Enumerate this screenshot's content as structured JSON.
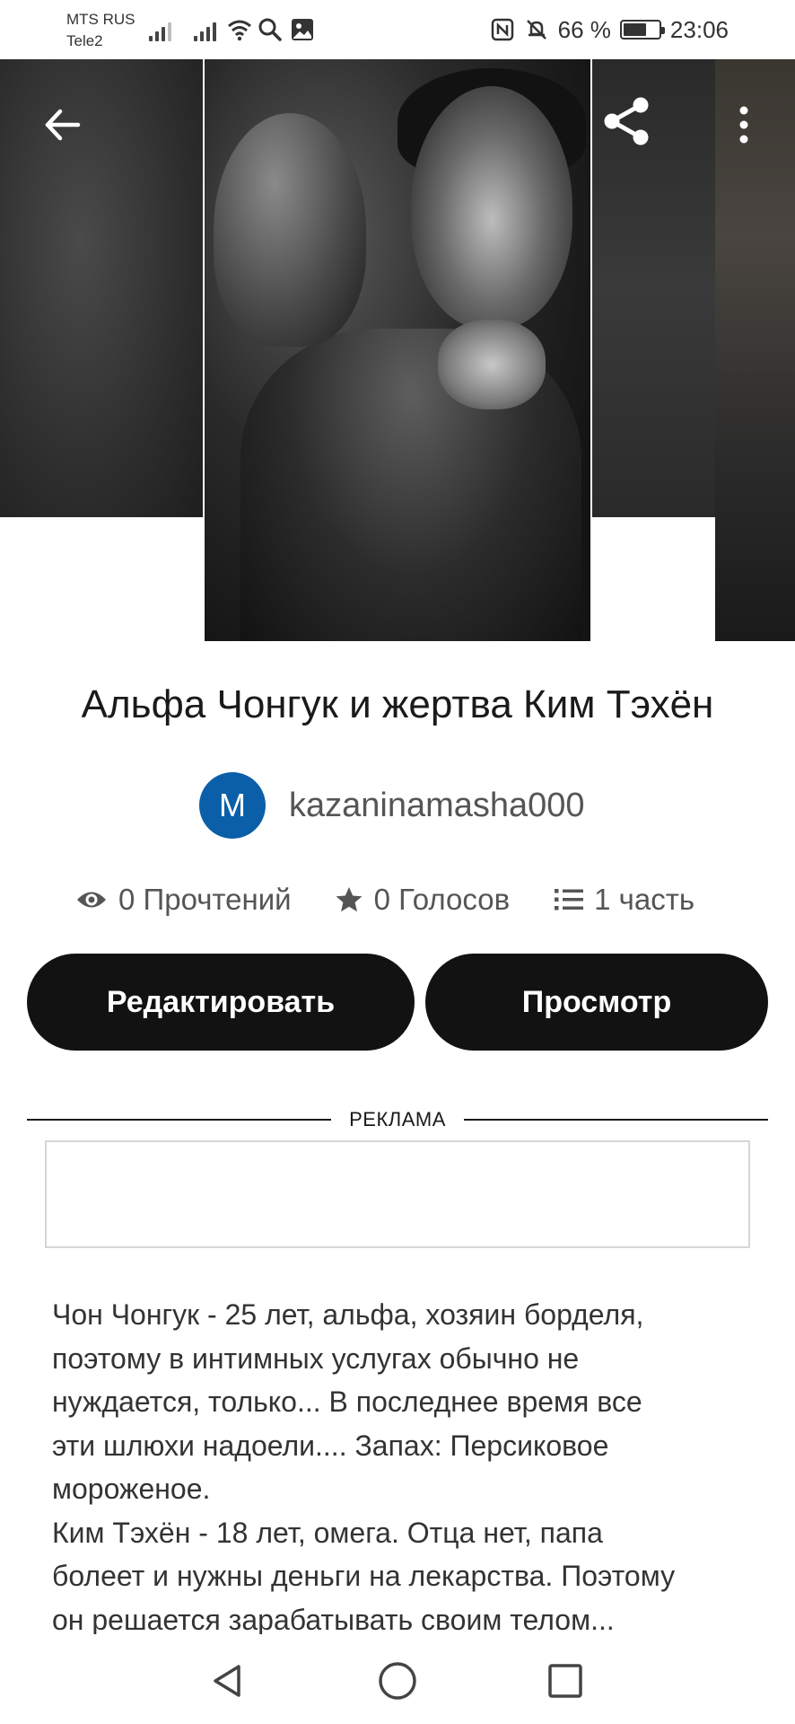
{
  "status_bar": {
    "carrier1": "MTS RUS",
    "carrier2": "Tele2",
    "battery": "66 %",
    "battery_level": 0.66,
    "time": "23:06"
  },
  "story": {
    "title": "Альфа Чонгук и жертва Ким Тэхён",
    "author_initial": "M",
    "author_name": "kazaninamasha000",
    "reads": "0 Прочтений",
    "votes": "0 Голосов",
    "parts": "1 часть",
    "edit_label": "Редактировать",
    "view_label": "Просмотр",
    "ad_label": "РЕКЛАМА",
    "description": "Чон Чонгук - 25 лет, альфа, хозяин борделя,\nпоэтому в интимных услугах обычно не\nнуждается, только... В последнее время все\nэти шлюхи надоели.... Запах: Персиковое\nмороженое.\nКим Тэхён - 18 лет, омега. Отца нет, папа\nболеет и нужны деньги на лекарства. Поэтому\nон решается зарабатывать своим телом..."
  },
  "colors": {
    "button_bg": "#121212",
    "avatar_bg": "#0b5fa8"
  },
  "icons": {
    "back": "arrow-left-icon",
    "share": "share-icon",
    "more": "more-vertical-icon",
    "reads": "eye-icon",
    "votes": "star-icon",
    "parts": "list-icon",
    "nav_back": "triangle-back-icon",
    "nav_home": "circle-home-icon",
    "nav_recent": "square-recent-icon"
  }
}
